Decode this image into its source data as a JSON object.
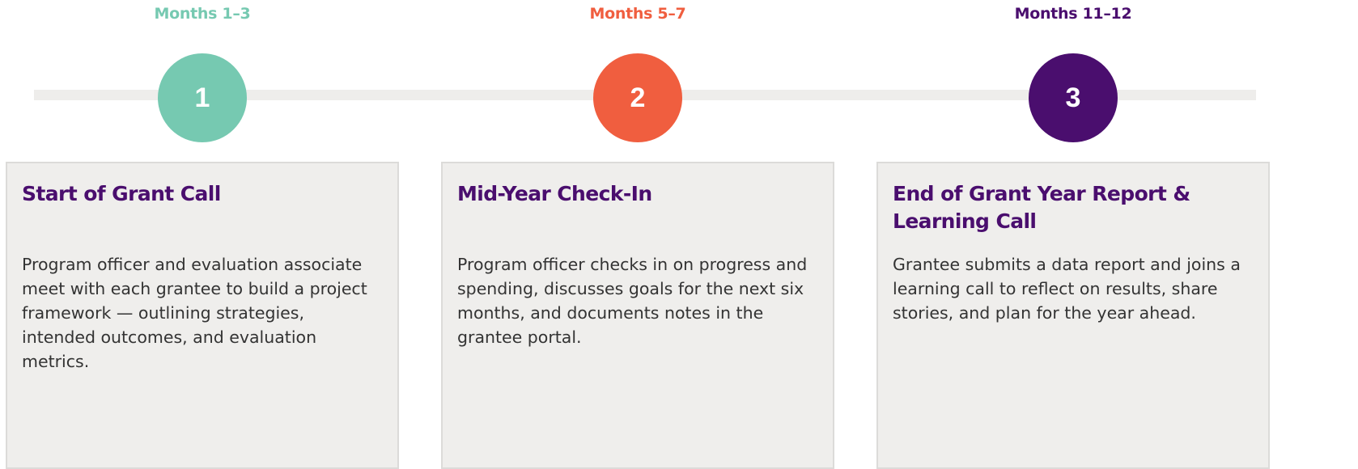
{
  "phases": [
    {
      "months": "Months 1–3",
      "step": "1",
      "color": "#76c9b1",
      "title": "Start of Grant Call",
      "description": "Program officer and evaluation associate meet with each grantee to build a project framework — outlining strategies, intended outcomes, and evaluation metrics."
    },
    {
      "months": "Months 5–7",
      "step": "2",
      "color": "#f05e3f",
      "title": "Mid-Year Check-In",
      "description": "Program officer checks in on progress and spending, discusses goals for the next six months, and documents notes in the grantee portal."
    },
    {
      "months": "Months 11–12",
      "step": "3",
      "color": "#4a0e6e",
      "title": "End of Grant Year Report & Learning Call",
      "description": "Grantee submits a data report and joins a learning call to reflect on results, share stories, and plan for the year ahead."
    }
  ],
  "theme": {
    "title_color": "#4a0e6e",
    "card_background": "#efeeec",
    "track_color": "#eeedeb"
  }
}
